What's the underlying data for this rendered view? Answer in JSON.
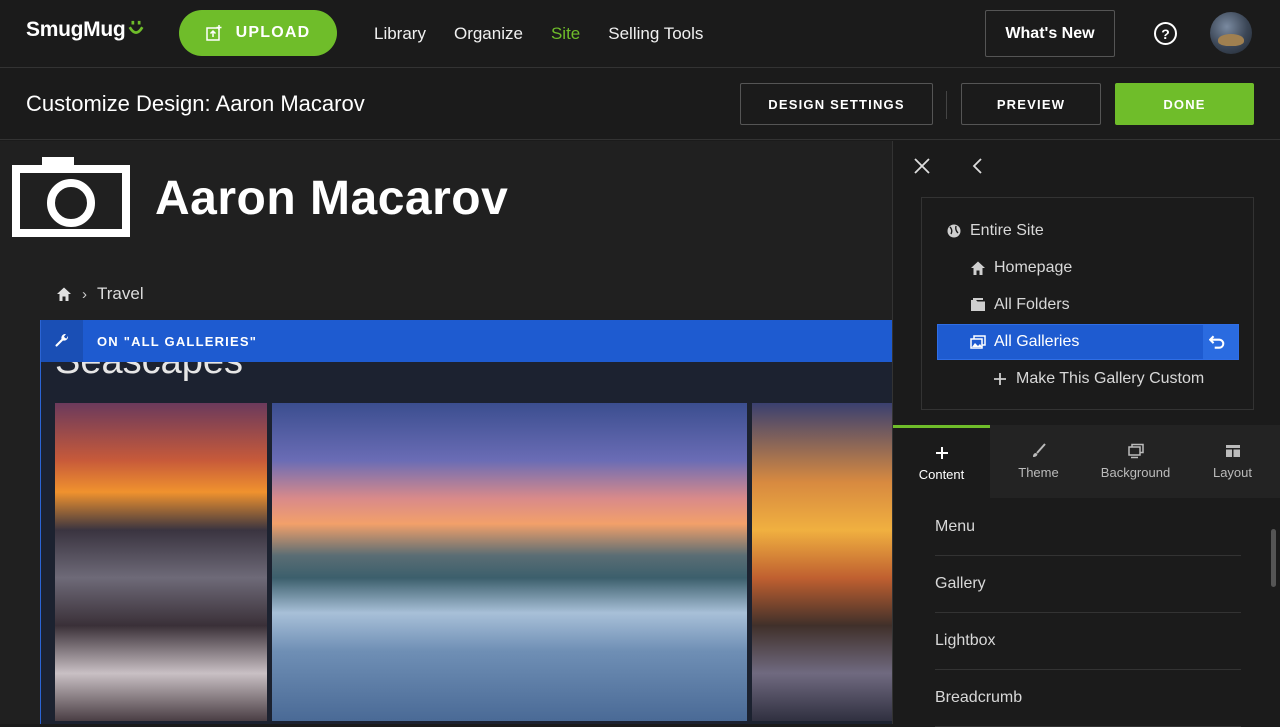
{
  "topbar": {
    "logo": "SmugMug",
    "upload_label": "UPLOAD",
    "nav": [
      "Library",
      "Organize",
      "Site",
      "Selling Tools"
    ],
    "active_nav": "Site",
    "whats_new": "What's New",
    "help": "?"
  },
  "subbar": {
    "title": "Customize Design: Aaron Macarov",
    "design_settings": "DESIGN SETTINGS",
    "preview": "PREVIEW",
    "done": "DONE"
  },
  "preview": {
    "site_name": "Aaron Macarov",
    "breadcrumb": [
      "Travel"
    ],
    "bar_label": "ON \"ALL GALLERIES\"",
    "gallery_title": "Seascapes"
  },
  "panel": {
    "tree": {
      "entire_site": "Entire Site",
      "homepage": "Homepage",
      "all_folders": "All Folders",
      "all_galleries": "All Galleries",
      "make_custom": "Make This Gallery Custom"
    },
    "tabs": [
      "Content",
      "Theme",
      "Background",
      "Layout"
    ],
    "active_tab": "Content",
    "content_items": [
      "Menu",
      "Gallery",
      "Lightbox",
      "Breadcrumb"
    ]
  },
  "colors": {
    "brand_green": "#6fbd2a",
    "selection_blue": "#1e5bd0",
    "background": "#1b1b1b"
  }
}
